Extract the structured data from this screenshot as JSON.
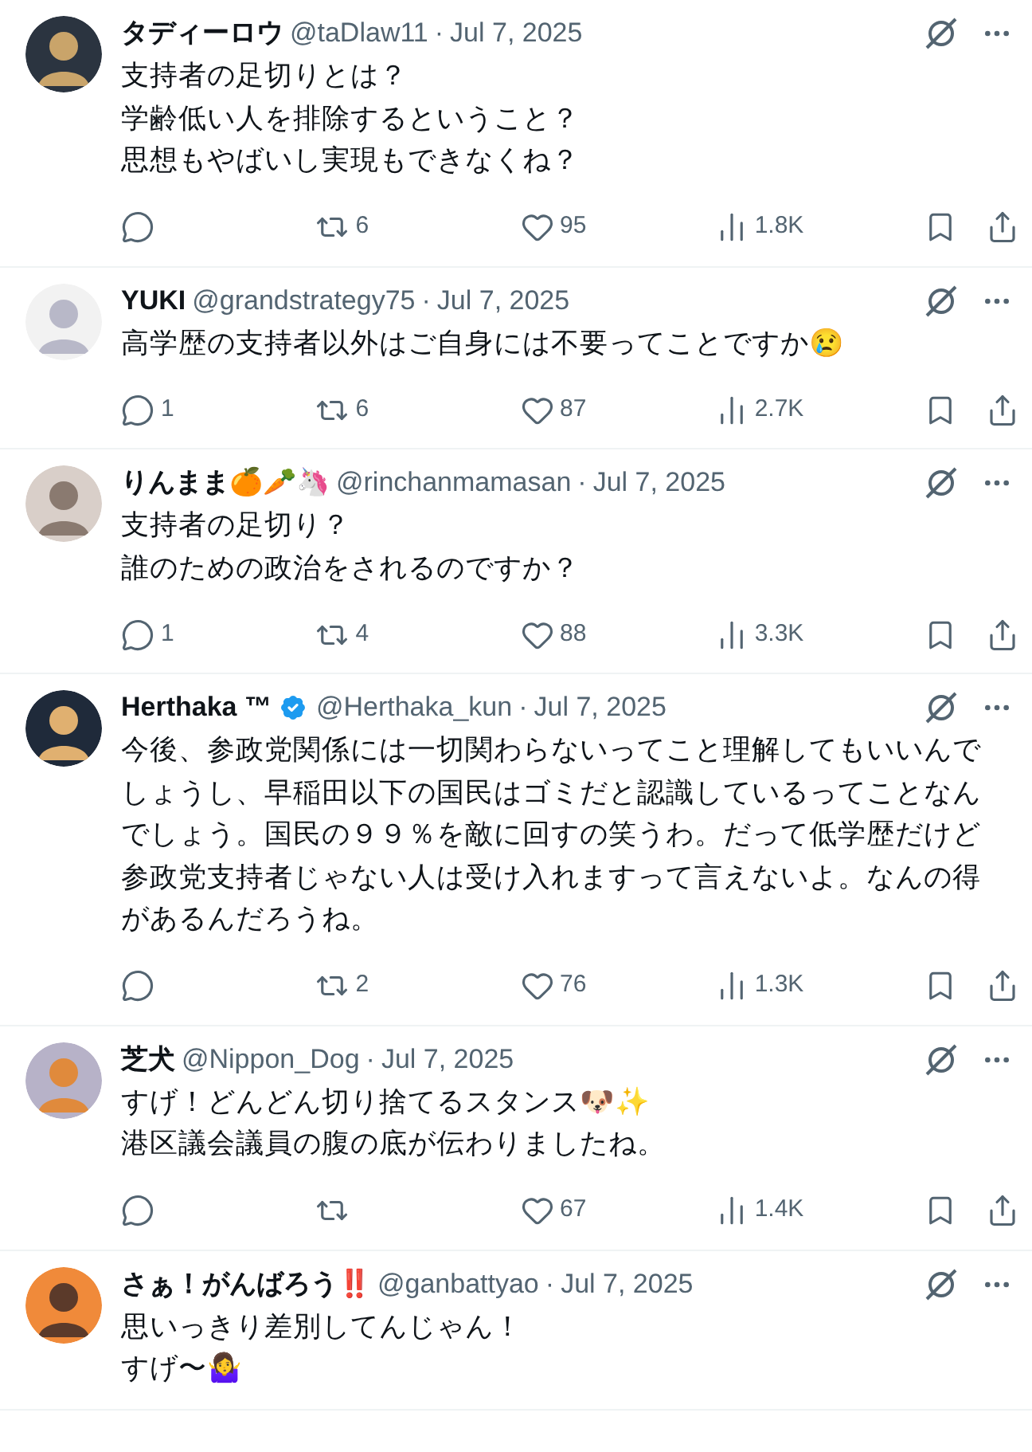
{
  "replies": [
    {
      "name": "タディーロウ",
      "verified": false,
      "handle": "@taDlaw11",
      "separator": "·",
      "date": "Jul 7, 2025",
      "lines": [
        "支持者の足切りとは？",
        "学齢低い人を排除するということ？",
        "思想もやばいし実現もできなくね？"
      ],
      "stats": {
        "reposts": "6",
        "likes": "95",
        "views": "1.8K"
      }
    },
    {
      "name": "YUKI",
      "verified": false,
      "handle": "@grandstrategy75",
      "separator": "·",
      "date": "Jul 7, 2025",
      "lines": [
        "高学歴の支持者以外はご自身には不要ってことですか😢"
      ],
      "stats": {
        "replies": "1",
        "reposts": "6",
        "likes": "87",
        "views": "2.7K"
      }
    },
    {
      "name": "りんまま🍊🥕🦄",
      "verified": false,
      "handle": "@rinchanmamasan",
      "separator": "·",
      "date": "Jul 7, 2025",
      "lines": [
        "支持者の足切り？",
        "誰のための政治をされるのですか？"
      ],
      "stats": {
        "replies": "1",
        "reposts": "4",
        "likes": "88",
        "views": "3.3K"
      }
    },
    {
      "name": "Herthaka ™",
      "verified": true,
      "handle": "@Herthaka_kun",
      "separator": "·",
      "date": "Jul 7, 2025",
      "lines": [
        "今後、参政党関係には一切関わらないってこと理解してもいいんで",
        "しょうし、早稲田以下の国民はゴミだと認識しているってことなん",
        "でしょう。国民の９９％を敵に回すの笑うわ。だって低学歴だけど",
        "参政党支持者じゃない人は受け入れますって言えないよ。なんの得",
        "があるんだろうね。"
      ],
      "stats": {
        "reposts": "2",
        "likes": "76",
        "views": "1.3K"
      }
    },
    {
      "name": "芝犬",
      "verified": false,
      "handle": "@Nippon_Dog",
      "separator": "·",
      "date": "Jul 7, 2025",
      "lines": [
        "すげ！どんどん切り捨てるスタンス🐶✨",
        "港区議会議員の腹の底が伝わりましたね。"
      ],
      "stats": {
        "likes": "67",
        "views": "1.4K"
      }
    },
    {
      "name": "さぁ！がんばろう‼️",
      "verified": false,
      "handle": "@ganbattyao",
      "separator": "·",
      "date": "Jul 7, 2025",
      "lines": [
        "思いっきり差別してんじゃん！",
        "すげ〜🤷‍♀️"
      ]
    }
  ]
}
